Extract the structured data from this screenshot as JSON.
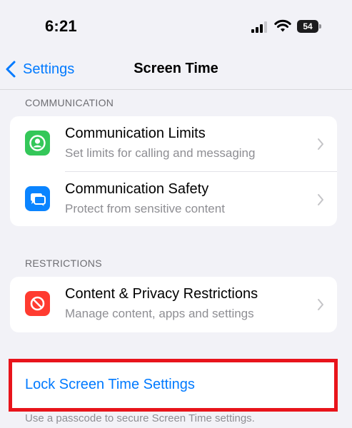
{
  "status_bar": {
    "time": "6:21",
    "battery_level": "54",
    "signal_icon": "cellular-signal-icon",
    "wifi_icon": "wifi-icon",
    "battery_icon": "battery-icon"
  },
  "nav": {
    "back_label": "Settings",
    "title": "Screen Time",
    "back_icon": "chevron-left-icon",
    "accent_color": "#007aff"
  },
  "communication": {
    "header": "COMMUNICATION",
    "items": [
      {
        "title": "Communication Limits",
        "subtitle": "Set limits for calling and messaging",
        "icon": "person-circle-icon",
        "icon_color": "#34c759"
      },
      {
        "title": "Communication Safety",
        "subtitle": "Protect from sensitive content",
        "icon": "message-bubble-icon",
        "icon_color": "#0a84ff"
      }
    ]
  },
  "restrictions": {
    "header": "RESTRICTIONS",
    "items": [
      {
        "title": "Content & Privacy Restrictions",
        "subtitle": "Manage content, apps and settings",
        "icon": "no-entry-icon",
        "icon_color": "#ff3b30"
      }
    ]
  },
  "lock": {
    "label": "Lock Screen Time Settings",
    "footer": "Use a passcode to secure Screen Time settings.",
    "highlight_color": "#e8141b"
  }
}
